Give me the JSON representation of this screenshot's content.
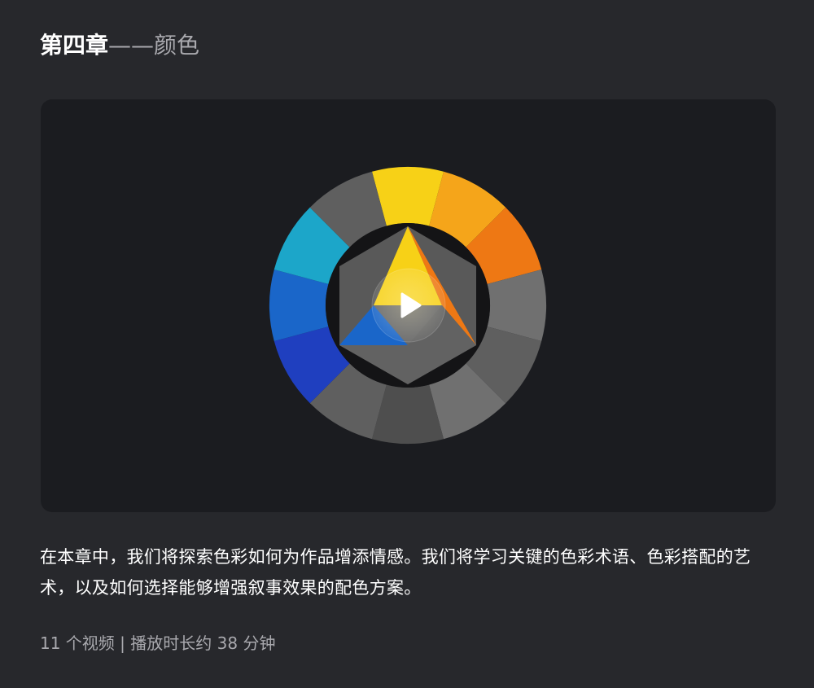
{
  "chapter": {
    "title_main": "第四章",
    "title_dash": "——",
    "title_sub": "颜色"
  },
  "video": {
    "play_icon": "play-icon",
    "thumbnail_icon": "color-wheel-icon",
    "wheel_colors": {
      "yellow": "#f7d117",
      "yellow_orange": "#f5a51a",
      "orange": "#ee7814",
      "cyan": "#1ca6c9",
      "blue": "#1a66c9",
      "dark_blue": "#1f3fbf",
      "gray_light": "#707070",
      "gray_mid": "#5f5f5f",
      "gray_dark": "#4e4e4e",
      "background": "#1b1c20"
    }
  },
  "description": "在本章中，我们将探索色彩如何为作品增添情感。我们将学习关键的色彩术语、色彩搭配的艺术，以及如何选择能够增强叙事效果的配色方案。",
  "meta": {
    "videos": "11 个视频",
    "separator": "|",
    "duration": "播放时长约 38 分钟"
  }
}
